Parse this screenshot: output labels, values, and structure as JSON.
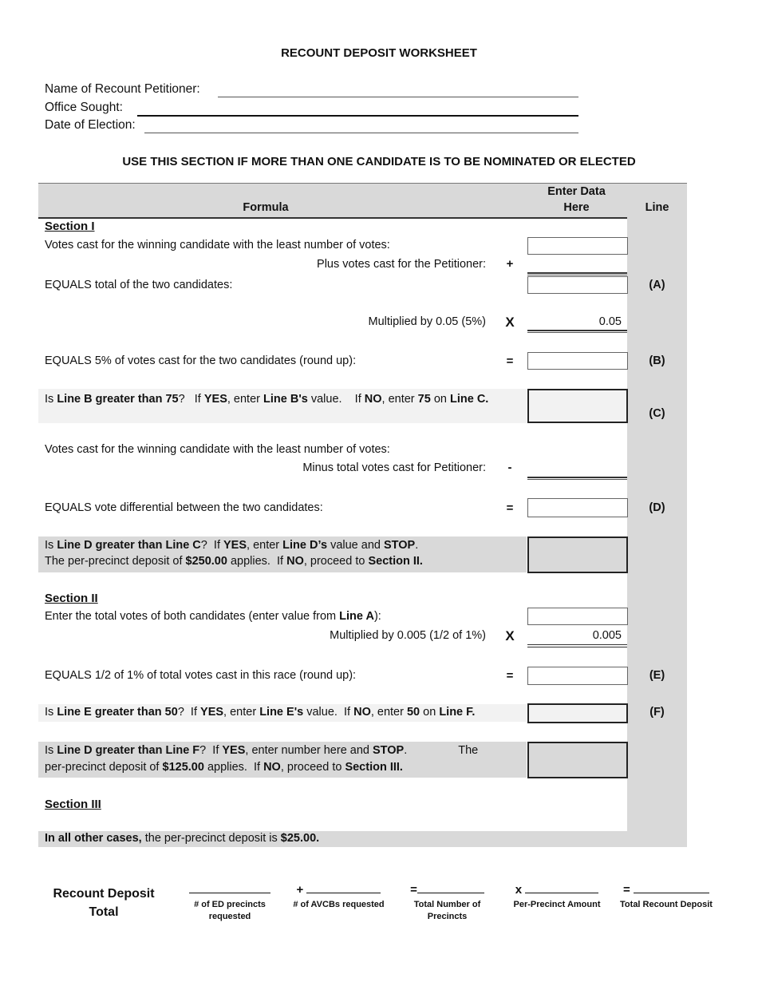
{
  "document": {
    "title": "RECOUNT DEPOSIT WORKSHEET",
    "fields": [
      {
        "label": "Name of Recount Petitioner:",
        "value": ""
      },
      {
        "label": "Office Sought:",
        "value": ""
      },
      {
        "label": "Date of Election:",
        "value": ""
      }
    ],
    "section_heading": "USE THIS SECTION IF MORE THAN ONE CANDIDATE IS TO BE NOMINATED OR ELECTED"
  },
  "table_header": {
    "formula": "Formula",
    "enter_data_1": "Enter Data",
    "enter_data_2": "Here",
    "line": "Line"
  },
  "section1": {
    "heading": "Section I",
    "rows": {
      "votes_winner": "Votes cast for the winning candidate with the least number of votes:",
      "plus_petitioner": "Plus votes cast for the Petitioner:",
      "equals_total": "EQUALS total of the two candidates:",
      "multiplied": "Multiplied by 0.05 (5%)",
      "multiplier_value": "0.05",
      "equals_5pct": "EQUALS 5% of votes cast for the two candidates (round up):",
      "line_c_q": "Is Line B greater than 75?  If YES, enter Line B's value.   If NO, enter 75 on Line C.",
      "votes_winner_2": "Votes cast for the winning candidate with the least number of votes:",
      "minus_petitioner": "Minus total votes cast for Petitioner:",
      "equals_diff": "EQUALS vote differential between the two candidates:",
      "line_d_q1": "Is Line D greater than Line C?  If YES, enter Line D's value and STOP.",
      "line_d_q2": "The per-precinct deposit of $250.00 applies.  If NO, proceed to Section II."
    },
    "ops": {
      "plus": "+",
      "times": "X",
      "equals": "=",
      "minus": "-"
    },
    "line_labels": {
      "A": "(A)",
      "B": "(B)",
      "C": "(C)",
      "D": "(D)"
    }
  },
  "section2": {
    "heading": "Section II",
    "rows": {
      "enter_total": "Enter the total votes of both candidates (enter value from Line A):",
      "multiplied": "Multiplied by 0.005 (1/2 of 1%)",
      "multiplier_value": "0.005",
      "equals_half": "EQUALS 1/2 of 1% of total votes cast in this race (round up):",
      "line_f_q": "Is Line E greater than 50?  If YES, enter Line E's value.  If NO, enter 50 on Line F.",
      "line_df_q1": "Is Line D greater than Line F?  If YES, enter number here and STOP.         The",
      "line_df_q2": "per-precinct deposit of $125.00 applies.  If NO, proceed to Section III."
    },
    "line_labels": {
      "E": "(E)",
      "F": "(F)"
    }
  },
  "section3": {
    "heading": "Section III",
    "text_bold": "In all other cases,",
    "text_rest": " the per-precinct deposit is ",
    "amount": "$25.00."
  },
  "footer": {
    "title_1": "Recount Deposit",
    "title_2": "Total",
    "columns": [
      {
        "prefix": "",
        "caption_1": "# of ED precincts",
        "caption_2": "requested"
      },
      {
        "prefix": "+",
        "caption_1": "# of AVCBs requested",
        "caption_2": ""
      },
      {
        "prefix": "=",
        "caption_1": "Total Number of",
        "caption_2": "Precincts"
      },
      {
        "prefix": "x",
        "caption_1": "Per-Precinct Amount",
        "caption_2": ""
      },
      {
        "prefix": "=",
        "caption_1": "Total Recount Deposit",
        "caption_2": ""
      }
    ]
  }
}
